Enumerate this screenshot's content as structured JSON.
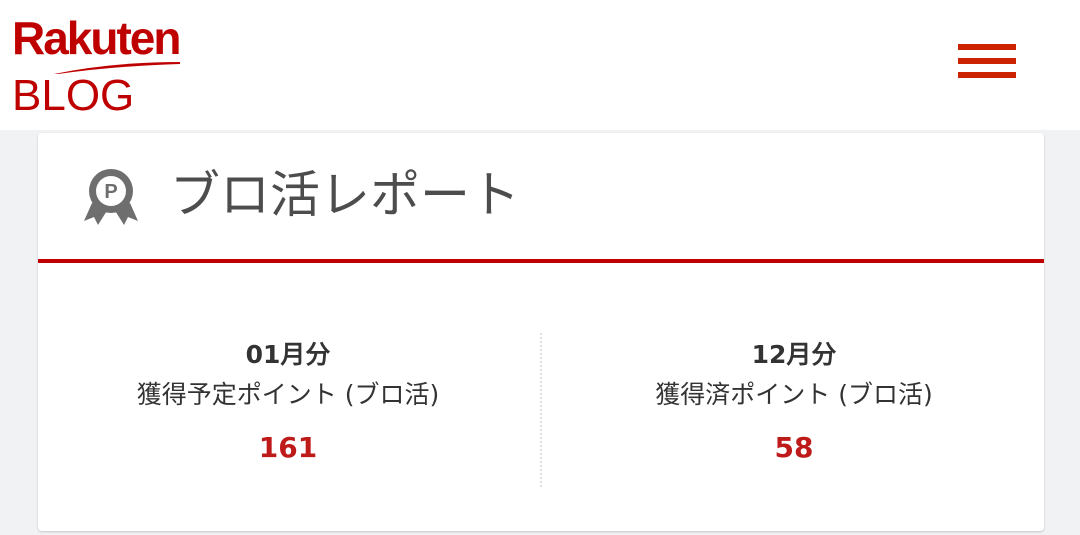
{
  "header": {
    "logo_brand": "Rakuten",
    "logo_sub": "BLOG",
    "menu_icon": "hamburger-icon",
    "brand_color": "#bf0000"
  },
  "report": {
    "title": "ブロ活レポート",
    "badge_icon": "point-badge-icon",
    "badge_letter": "P",
    "stats": [
      {
        "month": "01月分",
        "label": "獲得予定ポイント (ブロ活)",
        "value": "161"
      },
      {
        "month": "12月分",
        "label": "獲得済ポイント (ブロ活)",
        "value": "58"
      }
    ]
  }
}
